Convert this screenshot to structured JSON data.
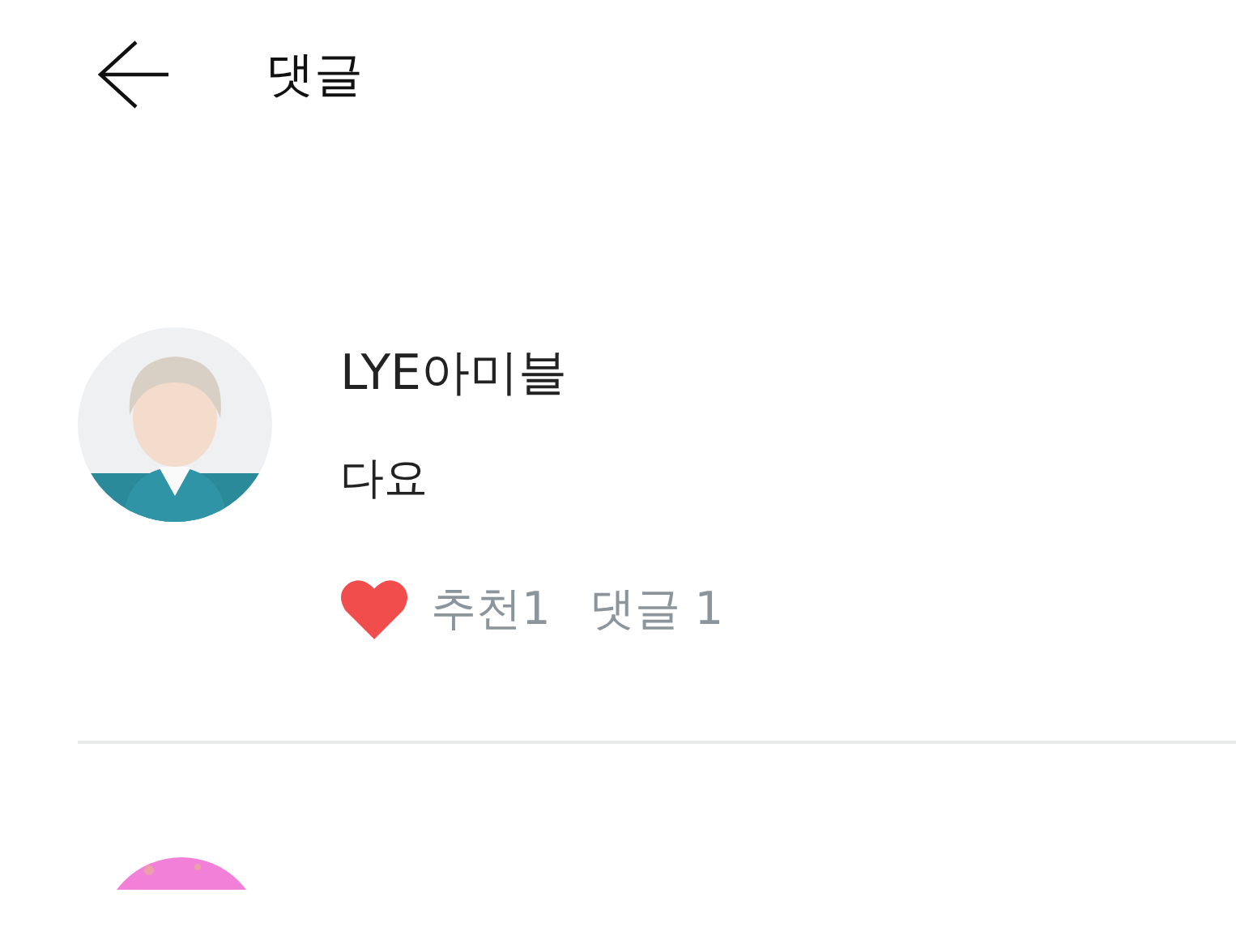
{
  "header": {
    "title": "댓글"
  },
  "comments": [
    {
      "author": "LYE아미블",
      "text": "다요",
      "liked": true,
      "likes": "추천1",
      "replies": "댓글 1"
    }
  ]
}
